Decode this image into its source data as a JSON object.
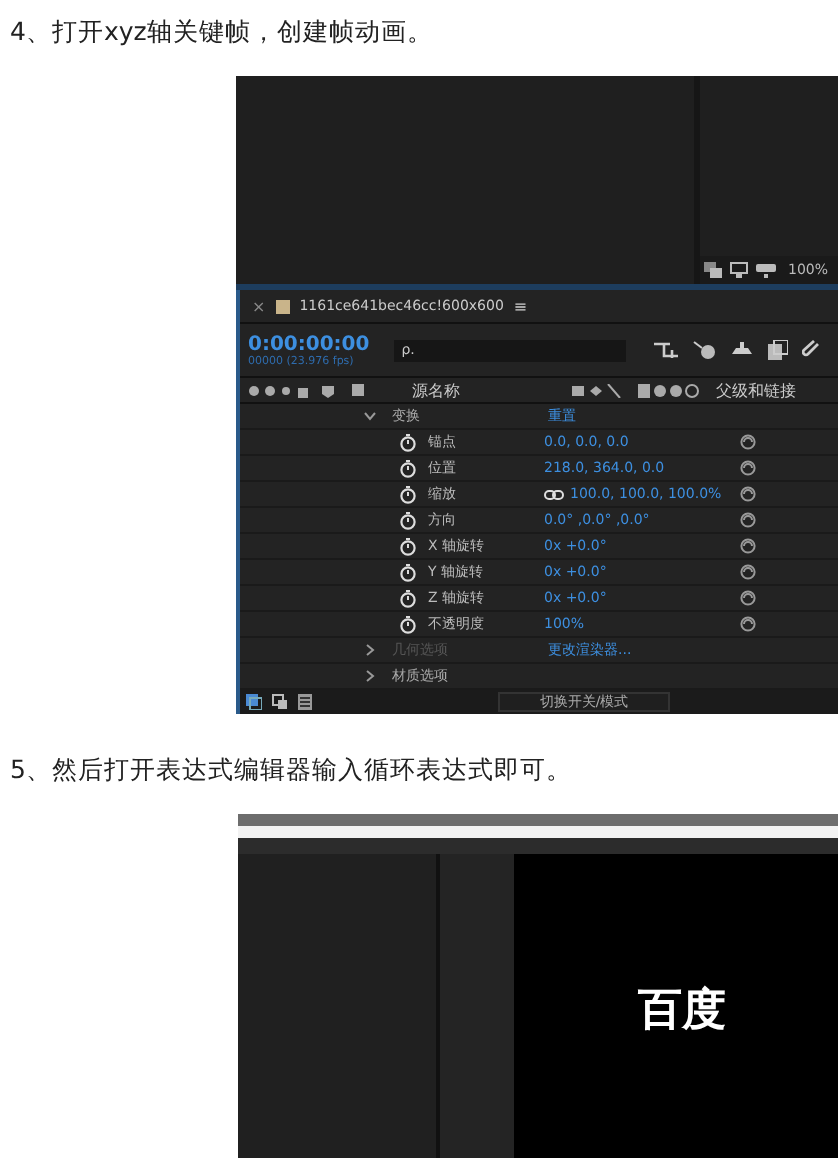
{
  "step4": {
    "text": "4、打开xyz轴关键帧，创建帧动画。"
  },
  "comp_viewer": {
    "zoom": "100%"
  },
  "timeline": {
    "close": "×",
    "tab_title": "1161ce641bec46cc!600x600",
    "menu": "≡",
    "timecode": "0:00:00:00",
    "frame_info": "00000 (23.976 fps)",
    "search_placeholder": "ρ.",
    "columns": {
      "source_name": "源名称",
      "parent": "父级和链接"
    },
    "properties": [
      {
        "kind": "group",
        "name": "变换",
        "value": "重置",
        "expanded": true,
        "disabled": false
      },
      {
        "kind": "property",
        "name": "锚点",
        "value": "0.0, 0.0, 0.0"
      },
      {
        "kind": "property",
        "name": "位置",
        "value": "218.0, 364.0, 0.0"
      },
      {
        "kind": "property",
        "name": "缩放",
        "value": "100.0, 100.0, 100.0%",
        "linked": true
      },
      {
        "kind": "property",
        "name": "方向",
        "value": "0.0° ,0.0° ,0.0°"
      },
      {
        "kind": "property",
        "name": "X 轴旋转",
        "value": "0x +0.0°"
      },
      {
        "kind": "property",
        "name": "Y 轴旋转",
        "value": "0x +0.0°"
      },
      {
        "kind": "property",
        "name": "Z 轴旋转",
        "value": "0x +0.0°"
      },
      {
        "kind": "property",
        "name": "不透明度",
        "value": "100%"
      },
      {
        "kind": "group",
        "name": "几何选项",
        "value": "更改渲染器...",
        "expanded": false,
        "disabled": true
      },
      {
        "kind": "group",
        "name": "材质选项",
        "expanded": false,
        "disabled": false
      }
    ],
    "toggle_button": "切换开关/模式"
  },
  "step5": {
    "text": "5、然后打开表达式编辑器输入循环表达式即可。"
  },
  "screenshot2": {
    "viewer_text": "百度"
  }
}
